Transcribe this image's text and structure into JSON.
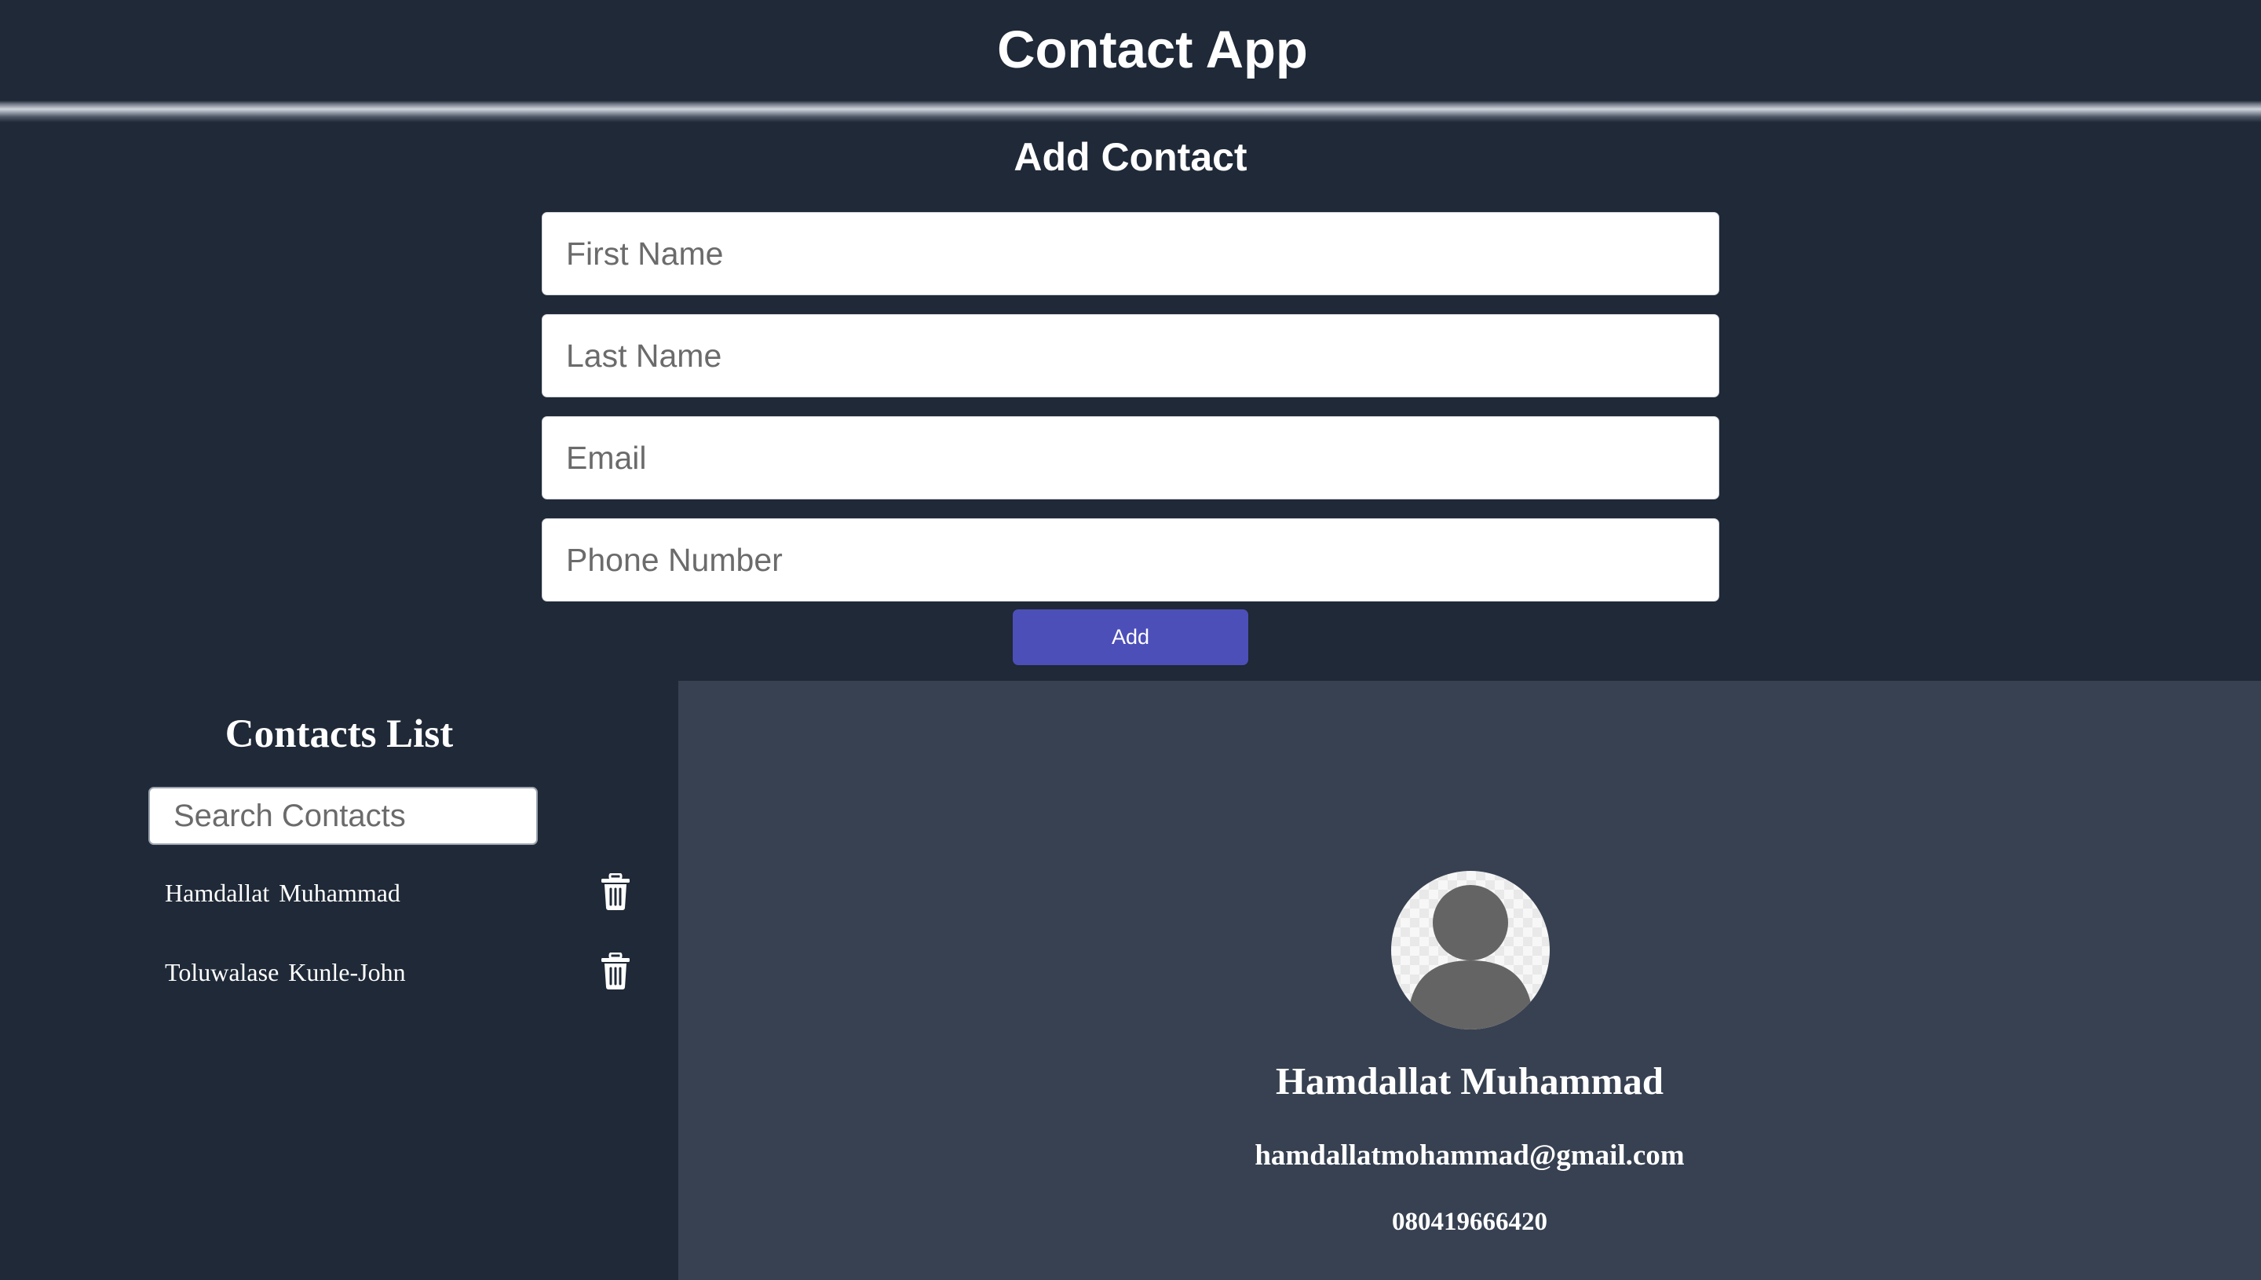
{
  "header": {
    "title": "Contact App"
  },
  "form": {
    "title": "Add Contact",
    "fields": {
      "first_name": {
        "placeholder": "First Name",
        "value": ""
      },
      "last_name": {
        "placeholder": "Last Name",
        "value": ""
      },
      "email": {
        "placeholder": "Email",
        "value": ""
      },
      "phone": {
        "placeholder": "Phone Number",
        "value": ""
      }
    },
    "submit_label": "Add"
  },
  "contacts_list": {
    "title": "Contacts List",
    "search": {
      "placeholder": "Search Contacts",
      "value": ""
    },
    "items": [
      {
        "first_name": "Hamdallat",
        "last_name": "Muhammad",
        "delete_icon": "trash-icon"
      },
      {
        "first_name": "Toluwalase",
        "last_name": "Kunle-John",
        "delete_icon": "trash-icon"
      }
    ]
  },
  "selected_contact": {
    "avatar_icon": "user-avatar-icon",
    "name": "Hamdallat Muhammad",
    "email": "hamdallatmohammad@gmail.com",
    "phone": "080419666420"
  },
  "colors": {
    "background": "#1f2937",
    "detail_panel": "#374151",
    "accent_button": "#4c4fb8",
    "text": "#ffffff",
    "avatar_figure": "#646464"
  }
}
